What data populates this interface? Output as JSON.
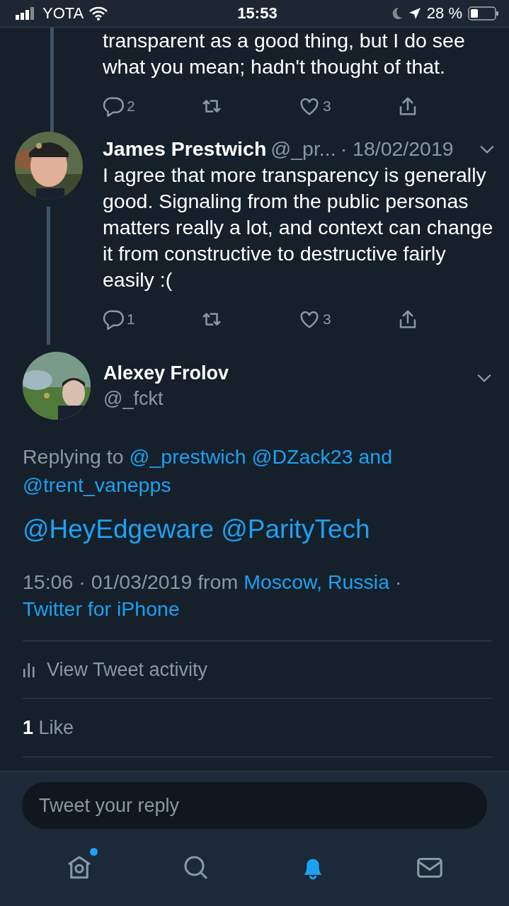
{
  "status_bar": {
    "carrier": "YOTA",
    "time": "15:53",
    "battery": "28 %"
  },
  "thread": [
    {
      "text_lines": [
        "transparent as a good thing, but I do see",
        "what you mean; hadn't thought of that."
      ],
      "replies": "2",
      "likes": "3"
    },
    {
      "name": "James Prestwich",
      "handle": "@_pr...",
      "date": "· 18/02/2019",
      "text": "I agree that more transparency is generally good. Signaling from the public personas matters really a lot, and context can change it from constructive to destructive fairly easily :(",
      "replies": "1",
      "likes": "3"
    }
  ],
  "main_tweet": {
    "name": "Alexey Frolov",
    "handle": "@_fckt",
    "replying_prefix": "Replying to",
    "replying_to": [
      "@_prestwich",
      "@DZack23",
      "and",
      "@trent_vanepps"
    ],
    "mentions": [
      "@HeyEdgeware",
      "@ParityTech"
    ],
    "timestamp": "15:06 · 01/03/2019 from",
    "location": "Moscow, Russia",
    "separator": "·",
    "source": "Twitter for iPhone",
    "activity": "View Tweet activity",
    "like_count": "1",
    "like_label": "Like"
  },
  "reply_field": {
    "placeholder": "Tweet your reply"
  },
  "tab_bar": [
    {
      "kind": "home",
      "selected": false,
      "badge": true
    },
    {
      "kind": "search",
      "selected": false,
      "badge": false
    },
    {
      "kind": "notifications",
      "selected": true,
      "badge": false
    },
    {
      "kind": "messages",
      "selected": false,
      "badge": false
    }
  ]
}
